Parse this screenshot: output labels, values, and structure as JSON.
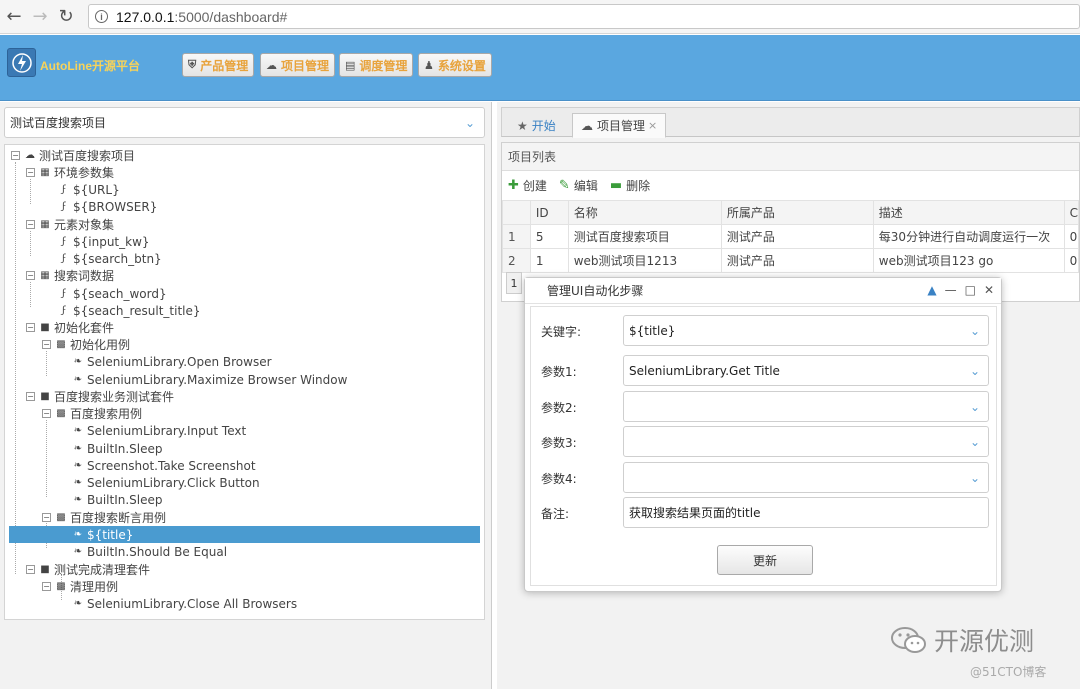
{
  "browser": {
    "url_host": "127.0.0.1",
    "url_rest": ":5000/dashboard#"
  },
  "header": {
    "logo_text": "AutoLine开源平台",
    "menu": [
      {
        "label": "产品管理"
      },
      {
        "label": "项目管理"
      },
      {
        "label": "调度管理"
      },
      {
        "label": "系统设置"
      }
    ]
  },
  "sidebar": {
    "project_select": "测试百度搜索项目",
    "tree": [
      {
        "label": "测试百度搜索项目"
      },
      {
        "label": "环境参数集"
      },
      {
        "label": "${URL}"
      },
      {
        "label": "${BROWSER}"
      },
      {
        "label": "元素对象集"
      },
      {
        "label": "${input_kw}"
      },
      {
        "label": "${search_btn}"
      },
      {
        "label": "搜索词数据"
      },
      {
        "label": "${seach_word}"
      },
      {
        "label": "${seach_result_title}"
      },
      {
        "label": "初始化套件"
      },
      {
        "label": "初始化用例"
      },
      {
        "label": "SeleniumLibrary.Open Browser"
      },
      {
        "label": "SeleniumLibrary.Maximize Browser Window"
      },
      {
        "label": "百度搜索业务测试套件"
      },
      {
        "label": "百度搜索用例"
      },
      {
        "label": "SeleniumLibrary.Input Text"
      },
      {
        "label": "BuiltIn.Sleep"
      },
      {
        "label": "Screenshot.Take Screenshot"
      },
      {
        "label": "SeleniumLibrary.Click Button"
      },
      {
        "label": "BuiltIn.Sleep"
      },
      {
        "label": "百度搜索断言用例"
      },
      {
        "label": "${title}"
      },
      {
        "label": "BuiltIn.Should Be Equal"
      },
      {
        "label": "测试完成清理套件"
      },
      {
        "label": "清理用例"
      },
      {
        "label": "SeleniumLibrary.Close All Browsers"
      }
    ]
  },
  "tabs": [
    {
      "label": "开始"
    },
    {
      "label": "项目管理",
      "close": "×"
    }
  ],
  "list": {
    "title": "项目列表",
    "toolbar": {
      "create": "创建",
      "edit": "编辑",
      "delete": "删除"
    },
    "columns": [
      "ID",
      "名称",
      "所属产品",
      "描述",
      "C"
    ],
    "rows": [
      {
        "rn": "1",
        "id": "5",
        "name": "测试百度搜索项目",
        "product": "测试产品",
        "desc": "每30分钟进行自动调度运行一次",
        "c": "0"
      },
      {
        "rn": "2",
        "id": "1",
        "name": "web测试项目1213",
        "product": "测试产品",
        "desc": "web测试项目123 go",
        "c": "0"
      }
    ],
    "page": "1"
  },
  "dialog": {
    "title": "管理UI自动化步骤",
    "keyword_label": "关键字:",
    "keyword_value": "${title}",
    "param1_label": "参数1:",
    "param1_value": "SeleniumLibrary.Get Title",
    "param2_label": "参数2:",
    "param2_value": "",
    "param3_label": "参数3:",
    "param3_value": "",
    "param4_label": "参数4:",
    "param4_value": "",
    "note_label": "备注:",
    "note_value": "获取搜索结果页面的title",
    "update_button": "更新"
  },
  "watermark": {
    "text": "开源优测",
    "sub": "@51CTO博客"
  },
  "colors": {
    "header_bg": "#5aa7e0",
    "menu_text": "#e8a33c",
    "selected_row": "#4a9bd0"
  }
}
